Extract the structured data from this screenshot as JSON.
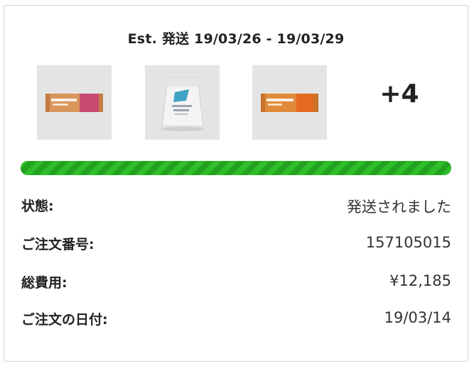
{
  "shipment": {
    "estimate": "Est. 発送 19/03/26 - 19/03/29",
    "extra_items": "+4",
    "progress": 1.0
  },
  "products": [
    {
      "name": "protein-bar-pink",
      "wrapper_color": "#d9955a",
      "accent_color": "#c94a6e"
    },
    {
      "name": "protein-pouch-white",
      "wrapper_color": "#f2f2f2",
      "accent_color": "#3ea3c4"
    },
    {
      "name": "protein-bar-orange",
      "wrapper_color": "#e08a3a",
      "accent_color": "#e56a1f"
    }
  ],
  "details": {
    "status_label": "状態:",
    "status_value": "発送されました",
    "order_number_label": "ご注文番号:",
    "order_number_value": "157105015",
    "total_label": "総費用:",
    "total_value": "¥12,185",
    "order_date_label": "ご注文の日付:",
    "order_date_value": "19/03/14"
  },
  "colors": {
    "progress": "#2fbe2a",
    "progress_stripe": "#22a21e",
    "thumb_bg": "#e4e4e4",
    "border": "#d4d4d4"
  }
}
